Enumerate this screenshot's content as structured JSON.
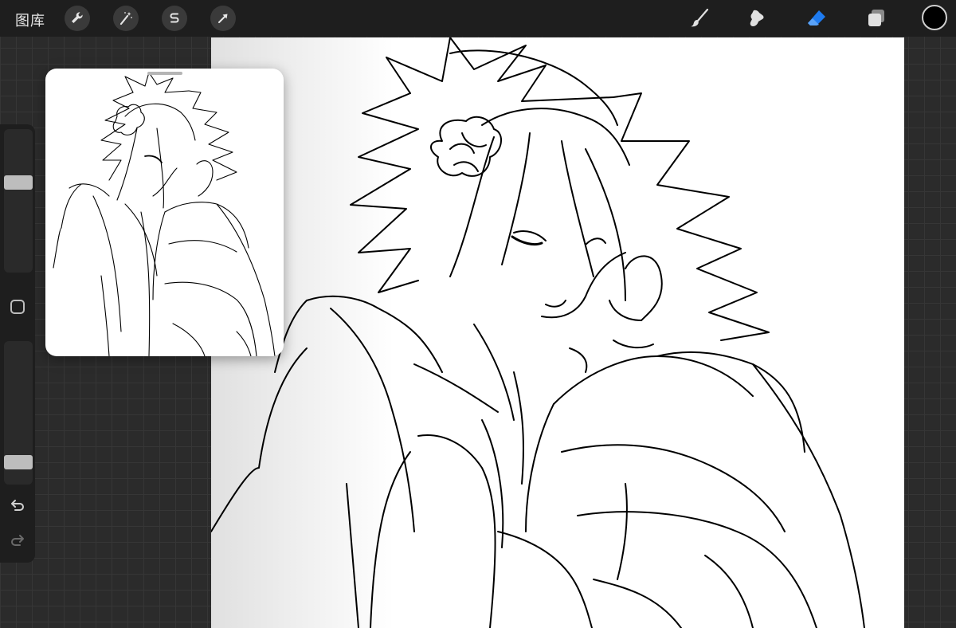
{
  "toolbar": {
    "gallery_label": "图库",
    "left_tools": [
      "wrench-icon",
      "magic-wand-icon",
      "selection-s-icon",
      "transform-arrow-icon"
    ],
    "right_tools": [
      "brush-icon",
      "smudge-icon",
      "eraser-icon",
      "layers-icon"
    ],
    "active_tool": "eraser-icon",
    "active_color": "#1e7bf0",
    "current_color": "#000000"
  },
  "sidebar": {
    "brush_size_level": 0.64,
    "opacity_level": 0.12
  }
}
